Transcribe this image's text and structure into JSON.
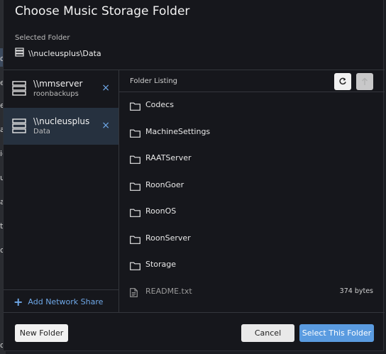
{
  "background": {
    "peek_letters": [
      "o",
      "er",
      "et",
      "a",
      "ic",
      "u",
      "ac",
      "tt",
      "co",
      "o"
    ]
  },
  "dialog": {
    "title": "Choose Music Storage Folder",
    "selected_label": "Selected Folder",
    "selected_path": "\\\\nucleusplus\\Data"
  },
  "shares": [
    {
      "name": "\\\\mmserver",
      "sub": "roonbackups",
      "remove": "×",
      "active": false
    },
    {
      "name": "\\\\nucleusplus",
      "sub": "Data",
      "remove": "×",
      "active": true
    }
  ],
  "add_share_label": "Add Network Share",
  "listing": {
    "header": "Folder Listing",
    "items": [
      {
        "name": "Codecs",
        "type": "folder",
        "size": ""
      },
      {
        "name": "MachineSettings",
        "type": "folder",
        "size": ""
      },
      {
        "name": "RAATServer",
        "type": "folder",
        "size": ""
      },
      {
        "name": "RoonGoer",
        "type": "folder",
        "size": ""
      },
      {
        "name": "RoonOS",
        "type": "folder",
        "size": ""
      },
      {
        "name": "RoonServer",
        "type": "folder",
        "size": ""
      },
      {
        "name": "Storage",
        "type": "folder",
        "size": ""
      },
      {
        "name": "README.txt",
        "type": "file",
        "size": "374 bytes"
      }
    ]
  },
  "footer": {
    "new_folder": "New Folder",
    "cancel": "Cancel",
    "select": "Select This Folder"
  },
  "colors": {
    "accent": "#5a9be0",
    "link": "#6fa8e8",
    "active_share_bg": "#26313f",
    "dialog_bg": "#16171c"
  }
}
